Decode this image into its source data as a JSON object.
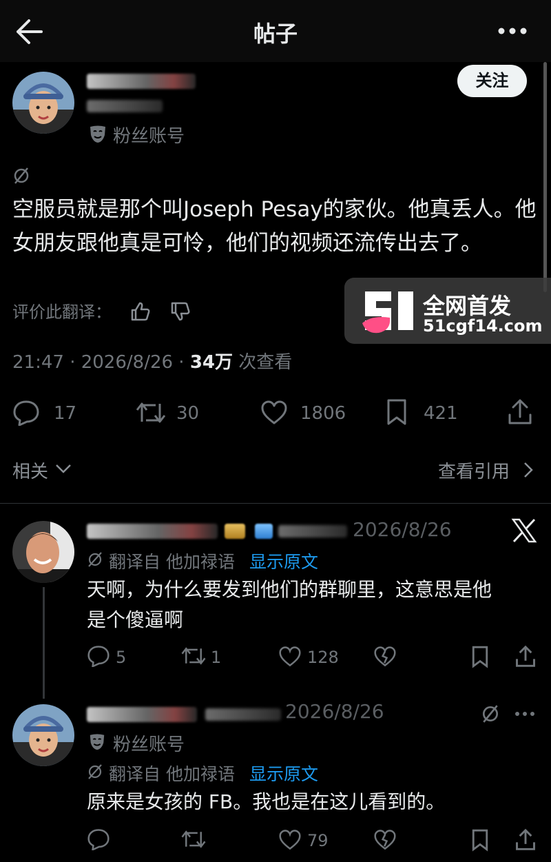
{
  "header": {
    "title": "帖子",
    "back_icon": "arrow-left-icon",
    "more_icon": "more-horizontal-icon"
  },
  "main_post": {
    "follow_label": "关注",
    "account_badge": "粉丝账号",
    "text": "空服员就是那个叫Joseph Pesay的家伙。他真丢人。他女朋友跟他真是可怜，他们的视频还流传出去了。",
    "rate_label": "评价此翻译：",
    "time": "21:47 · 2026/8/26 ·",
    "views_count": "34万",
    "views_label": "次查看",
    "replies": "17",
    "reposts": "30",
    "likes": "1806",
    "bookmarks": "421",
    "related_label": "相关",
    "quotes_label": "查看引用"
  },
  "watermark": {
    "title": "全网首发",
    "url": "51cgf14.com"
  },
  "replies": [
    {
      "date": "2026/8/26",
      "translated_label": "翻译自 他加禄语",
      "show_original": "显示原文",
      "text_line1": "天啊，为什么要发到他们的群聊里，这意思是他",
      "text_line2": "是个傻逼啊",
      "replies": "5",
      "reposts": "1",
      "likes": "128"
    },
    {
      "date": "2026/8/26",
      "account_badge": "粉丝账号",
      "translated_label": "翻译自 他加禄语",
      "show_original": "显示原文",
      "text": "原来是女孩的 FB。我也是在这儿看到的。",
      "likes": "79"
    }
  ],
  "colors": {
    "background": "#000000",
    "text": "#e7e9ea",
    "muted": "#71767b",
    "link": "#1d9bf0"
  }
}
